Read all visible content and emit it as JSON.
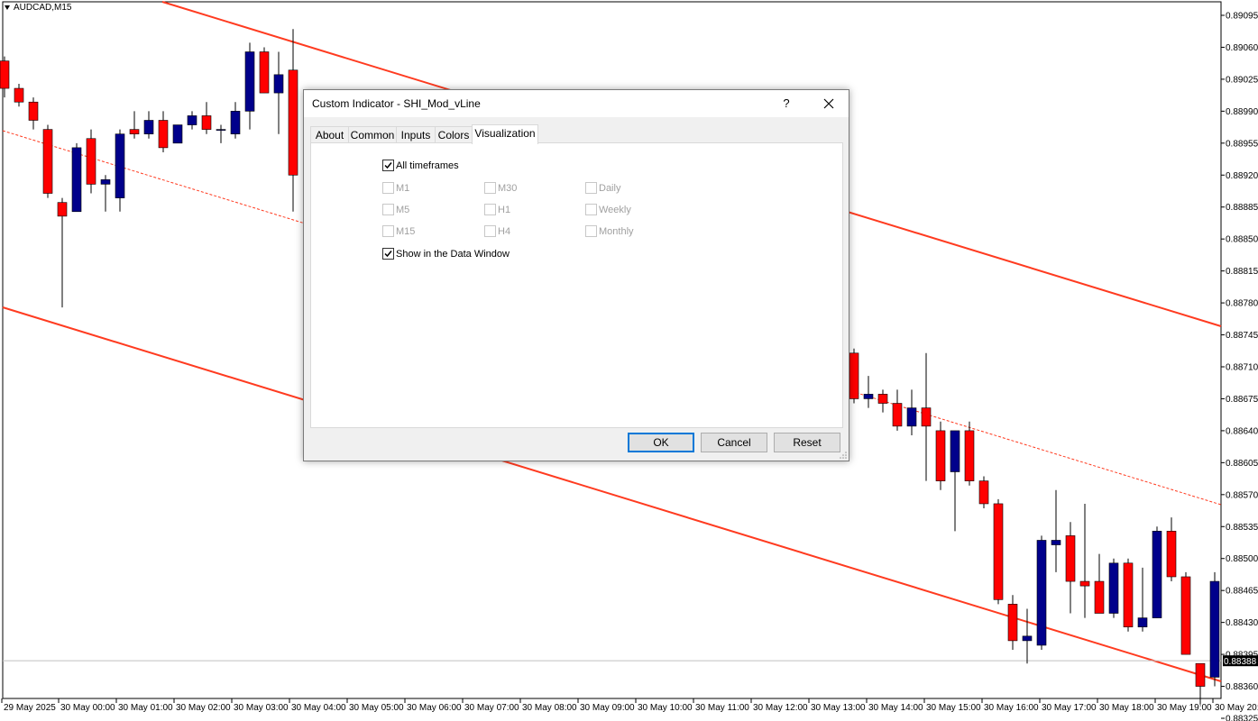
{
  "chart": {
    "symbol": "AUDCAD,M15",
    "price_labels": [
      "0.89095",
      "0.89060",
      "0.89025",
      "0.88990",
      "0.88955",
      "0.88920",
      "0.88885",
      "0.88850",
      "0.88815",
      "0.88780",
      "0.88745",
      "0.88710",
      "0.88675",
      "0.88640",
      "0.88605",
      "0.88570",
      "0.88535",
      "0.88500",
      "0.88465",
      "0.88430",
      "0.88395",
      "0.88360",
      "0.88325"
    ],
    "current_price": "0.88388",
    "time_labels": [
      "29 May 2025",
      "30 May 00:00",
      "30 May 01:00",
      "30 May 02:00",
      "30 May 03:00",
      "30 May 04:00",
      "30 May 05:00",
      "30 May 06:00",
      "30 May 07:00",
      "30 May 08:00",
      "30 May 09:00",
      "30 May 10:00",
      "30 May 11:00",
      "30 May 12:00",
      "30 May 13:00",
      "30 May 14:00",
      "30 May 15:00",
      "30 May 16:00",
      "30 May 17:00",
      "30 May 18:00",
      "30 May 19:00",
      "30 May 20:"
    ],
    "colors": {
      "bull": "#00008b",
      "bear": "#ff0000",
      "channel": "#ff3b20"
    }
  },
  "chart_data": {
    "type": "candlestick",
    "ylim": [
      0.88325,
      0.89095
    ],
    "candles": [
      {
        "o": 0.89045,
        "h": 0.8905,
        "l": 0.89005,
        "c": 0.89015
      },
      {
        "o": 0.89015,
        "h": 0.8902,
        "l": 0.88995,
        "c": 0.89
      },
      {
        "o": 0.89,
        "h": 0.89005,
        "l": 0.8897,
        "c": 0.8898
      },
      {
        "o": 0.8897,
        "h": 0.88975,
        "l": 0.88895,
        "c": 0.889
      },
      {
        "o": 0.8889,
        "h": 0.88895,
        "l": 0.88775,
        "c": 0.88875
      },
      {
        "o": 0.8888,
        "h": 0.88955,
        "l": 0.8888,
        "c": 0.8895
      },
      {
        "o": 0.8896,
        "h": 0.8897,
        "l": 0.889,
        "c": 0.8891
      },
      {
        "o": 0.8891,
        "h": 0.8892,
        "l": 0.8888,
        "c": 0.88915
      },
      {
        "o": 0.88895,
        "h": 0.8897,
        "l": 0.8888,
        "c": 0.88965
      },
      {
        "o": 0.8897,
        "h": 0.8899,
        "l": 0.8896,
        "c": 0.88965
      },
      {
        "o": 0.88965,
        "h": 0.8899,
        "l": 0.8896,
        "c": 0.8898
      },
      {
        "o": 0.8898,
        "h": 0.8899,
        "l": 0.88945,
        "c": 0.8895
      },
      {
        "o": 0.88955,
        "h": 0.88975,
        "l": 0.88955,
        "c": 0.88975
      },
      {
        "o": 0.88975,
        "h": 0.8899,
        "l": 0.8897,
        "c": 0.88985
      },
      {
        "o": 0.88985,
        "h": 0.89,
        "l": 0.88965,
        "c": 0.8897
      },
      {
        "o": 0.8897,
        "h": 0.88975,
        "l": 0.88955,
        "c": 0.8897
      },
      {
        "o": 0.88965,
        "h": 0.89,
        "l": 0.8896,
        "c": 0.8899
      },
      {
        "o": 0.8899,
        "h": 0.89065,
        "l": 0.8897,
        "c": 0.89055
      },
      {
        "o": 0.89055,
        "h": 0.8906,
        "l": 0.8901,
        "c": 0.8901
      },
      {
        "o": 0.8901,
        "h": 0.89055,
        "l": 0.88965,
        "c": 0.8903
      },
      {
        "o": 0.89035,
        "h": 0.8908,
        "l": 0.8888,
        "c": 0.8892
      },
      {
        "o": 0.88725,
        "h": 0.8873,
        "l": 0.8867,
        "c": 0.88675
      },
      {
        "o": 0.88675,
        "h": 0.887,
        "l": 0.88665,
        "c": 0.8868
      },
      {
        "o": 0.8868,
        "h": 0.88685,
        "l": 0.8866,
        "c": 0.8867
      },
      {
        "o": 0.8867,
        "h": 0.88685,
        "l": 0.8864,
        "c": 0.88645
      },
      {
        "o": 0.88645,
        "h": 0.88685,
        "l": 0.88635,
        "c": 0.88665
      },
      {
        "o": 0.88665,
        "h": 0.88725,
        "l": 0.88585,
        "c": 0.88645
      },
      {
        "o": 0.8864,
        "h": 0.8865,
        "l": 0.88575,
        "c": 0.88585
      },
      {
        "o": 0.88595,
        "h": 0.8864,
        "l": 0.8853,
        "c": 0.8864
      },
      {
        "o": 0.8864,
        "h": 0.8865,
        "l": 0.8858,
        "c": 0.88585
      },
      {
        "o": 0.88585,
        "h": 0.8859,
        "l": 0.88555,
        "c": 0.8856
      },
      {
        "o": 0.8856,
        "h": 0.88565,
        "l": 0.8845,
        "c": 0.88455
      },
      {
        "o": 0.8845,
        "h": 0.8846,
        "l": 0.884,
        "c": 0.8841
      },
      {
        "o": 0.8841,
        "h": 0.88445,
        "l": 0.88385,
        "c": 0.88415
      },
      {
        "o": 0.88405,
        "h": 0.88525,
        "l": 0.884,
        "c": 0.8852
      },
      {
        "o": 0.88515,
        "h": 0.88575,
        "l": 0.88485,
        "c": 0.8852
      },
      {
        "o": 0.88525,
        "h": 0.8854,
        "l": 0.8844,
        "c": 0.88475
      },
      {
        "o": 0.88475,
        "h": 0.8856,
        "l": 0.88435,
        "c": 0.8847
      },
      {
        "o": 0.88475,
        "h": 0.88505,
        "l": 0.8844,
        "c": 0.8844
      },
      {
        "o": 0.8844,
        "h": 0.885,
        "l": 0.88435,
        "c": 0.88495
      },
      {
        "o": 0.88495,
        "h": 0.885,
        "l": 0.8842,
        "c": 0.88425
      },
      {
        "o": 0.88425,
        "h": 0.8849,
        "l": 0.8842,
        "c": 0.88435
      },
      {
        "o": 0.88435,
        "h": 0.88535,
        "l": 0.88435,
        "c": 0.8853
      },
      {
        "o": 0.8853,
        "h": 0.88545,
        "l": 0.88475,
        "c": 0.8848
      },
      {
        "o": 0.8848,
        "h": 0.88485,
        "l": 0.88395,
        "c": 0.88395
      },
      {
        "o": 0.88385,
        "h": 0.88385,
        "l": 0.8834,
        "c": 0.8836
      },
      {
        "o": 0.8837,
        "h": 0.88485,
        "l": 0.8836,
        "c": 0.88475
      }
    ]
  },
  "dialog": {
    "title": "Custom Indicator - SHI_Mod_vLine",
    "help": "?",
    "tabs": [
      "About",
      "Common",
      "Inputs",
      "Colors",
      "Visualization"
    ],
    "active_tab": "Visualization",
    "all_timeframes": {
      "label": "All timeframes",
      "checked": true
    },
    "timeframes": [
      "M1",
      "M5",
      "M15",
      "M30",
      "H1",
      "H4",
      "Daily",
      "Weekly",
      "Monthly"
    ],
    "show_data_window": {
      "label": "Show in the Data Window",
      "checked": true
    },
    "buttons": {
      "ok": "OK",
      "cancel": "Cancel",
      "reset": "Reset"
    }
  }
}
